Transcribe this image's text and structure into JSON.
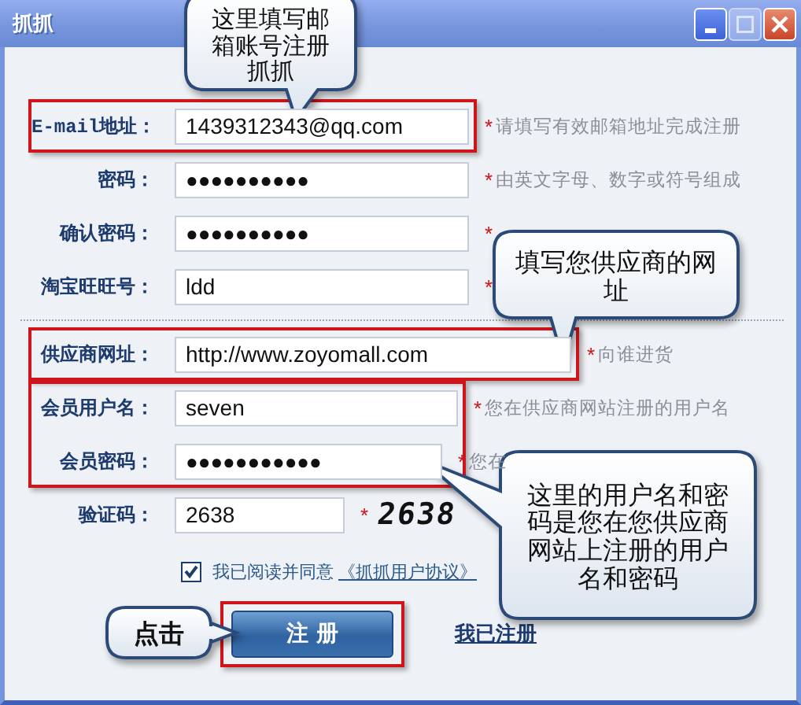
{
  "window": {
    "title": "抓抓",
    "controls": [
      {
        "kind": "minimize",
        "disabled": false
      },
      {
        "kind": "maximize",
        "disabled": true
      },
      {
        "kind": "close",
        "disabled": false
      }
    ]
  },
  "sections": [
    {
      "groups": [
        {
          "highlighted": true,
          "fields": [
            {
              "label": "E-mail地址：",
              "kind": "text",
              "value": "1439312343@qq.com",
              "required_mark": "*",
              "hint": "请填写有效邮箱地址完成注册"
            }
          ]
        },
        {
          "highlighted": false,
          "fields": [
            {
              "label": "密码：",
              "kind": "password",
              "value": "●●●●●●●●●●",
              "required_mark": "*",
              "hint": "由英文字母、数字或符号组成"
            },
            {
              "label": "确认密码：",
              "kind": "password",
              "value": "●●●●●●●●●●",
              "required_mark": "*"
            },
            {
              "label": "淘宝旺旺号：",
              "kind": "text",
              "value": "ldd",
              "required_mark": "*"
            }
          ]
        }
      ]
    },
    {
      "groups": [
        {
          "highlighted": true,
          "fields": [
            {
              "label": "供应商网址：",
              "kind": "text",
              "value": "http://www.zoyomall.com",
              "required_mark": "*",
              "hint": "向谁进货"
            }
          ]
        },
        {
          "highlighted": true,
          "fields": [
            {
              "label": "会员用户名：",
              "kind": "text",
              "value": "seven",
              "required_mark": "*",
              "hint": "您在供应商网站注册的用户名"
            },
            {
              "label": "会员密码：",
              "kind": "password",
              "value": "●●●●●●●●●●●",
              "required_mark": "*",
              "hint": "您在"
            }
          ]
        },
        {
          "highlighted": false,
          "fields": [
            {
              "label": "验证码：",
              "kind": "captcha",
              "value": "2638",
              "required_mark": "*",
              "captcha": "2638"
            }
          ]
        }
      ]
    }
  ],
  "agreement": {
    "checked": true,
    "text": "我已阅读并同意",
    "link": "《抓抓用户协议》"
  },
  "submit_button": {
    "label": "注 册",
    "highlighted": true
  },
  "login_link": "我已注册",
  "callouts": [
    {
      "text": "这里填写邮箱账号注册抓抓",
      "bold": false
    },
    {
      "text": "填写您供应商的网址",
      "bold": false
    },
    {
      "text": "这里的用户名和密码是您在您供应商网站上注册的用户名和密码",
      "bold": false
    },
    {
      "text": "点击",
      "bold": true
    }
  ]
}
